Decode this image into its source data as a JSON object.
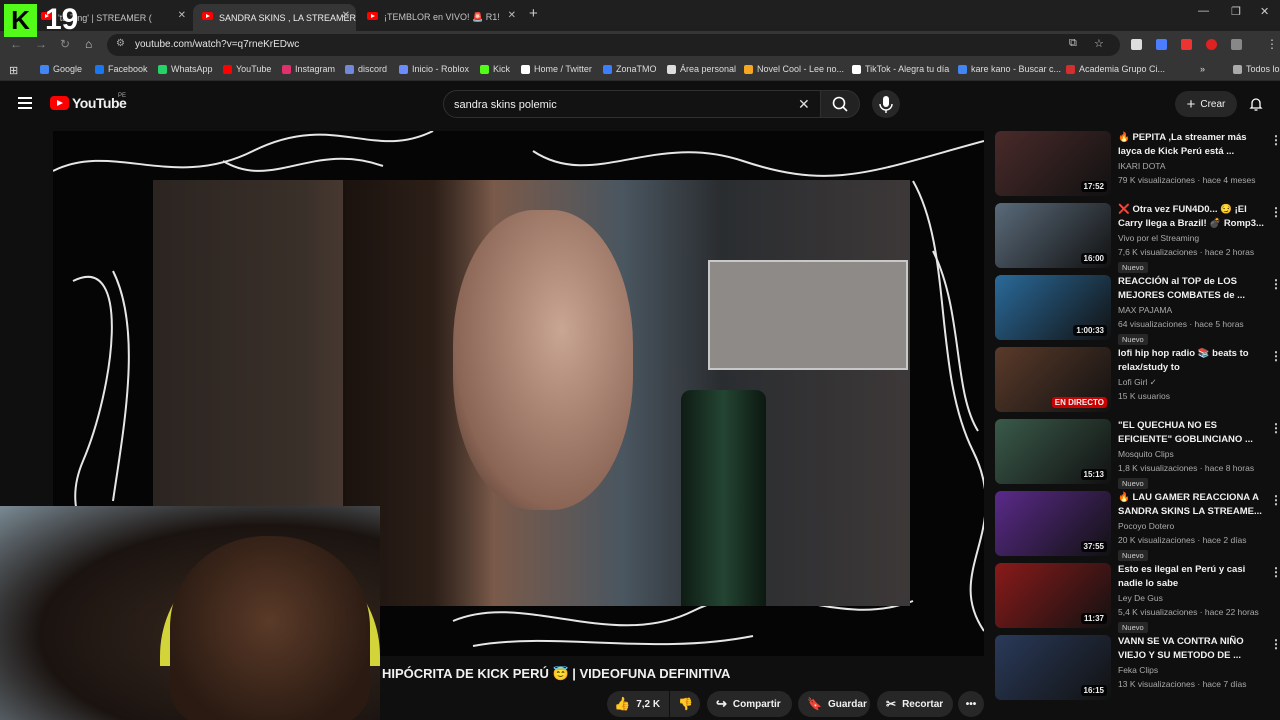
{
  "tabs": [
    {
      "label": "'ta Zing' | STREAMER ("
    },
    {
      "label": "SANDRA SKINS , LA STREAMER"
    },
    {
      "label": "¡TEMBLOR en VIVO! 🚨 R1!"
    }
  ],
  "address": {
    "url": "youtube.com/watch?v=q7rneKrEDwc"
  },
  "bookmarks": [
    {
      "label": "Google",
      "color": "#4285f4"
    },
    {
      "label": "Facebook",
      "color": "#1877f2"
    },
    {
      "label": "WhatsApp",
      "color": "#25d366"
    },
    {
      "label": "YouTube",
      "color": "#ff0000"
    },
    {
      "label": "Instagram",
      "color": "#e1306c"
    },
    {
      "label": "discord",
      "color": "#7289da"
    },
    {
      "label": "Inicio - Roblox",
      "color": "#6b8cff"
    },
    {
      "label": "Kick",
      "color": "#53fc18"
    },
    {
      "label": "Home / Twitter",
      "color": "#ffffff"
    },
    {
      "label": "ZonaTMO",
      "color": "#3d7eff"
    },
    {
      "label": "Área personal",
      "color": "#dddddd"
    },
    {
      "label": "Novel Cool - Lee no...",
      "color": "#f5a623"
    },
    {
      "label": "TikTok - Alegra tu día",
      "color": "#ffffff"
    },
    {
      "label": "kare kano - Buscar c...",
      "color": "#4285f4"
    },
    {
      "label": "Academia Grupo Ci...",
      "color": "#d32f2f"
    }
  ],
  "bookmarks_other": "Todos los",
  "youtube": {
    "logo": "YouTube",
    "country": "PE",
    "search_query": "sandra skins polemic",
    "create_label": "Crear"
  },
  "overlay": {
    "number": "19",
    "k_logo": "K"
  },
  "video": {
    "title": "HIPÓCRITA DE KICK PERÚ 😇 | VIDEOFUNA DEFINITIVA",
    "likes": "7,2 K",
    "share_label": "Compartir",
    "save_label": "Guardar",
    "clip_label": "Recortar"
  },
  "related": [
    {
      "title": "🔥 PEPITA ,La streamer más layca de Kick Perú está ...",
      "channel": "IKARI DOTA",
      "meta": "79 K visualizaciones · hace 4 meses",
      "duration": "17:52",
      "badge": "",
      "thumb": "#4a2a2a"
    },
    {
      "title": "❌ Otra vez FUN4D0... 😏 ¡El Carry llega a Brazil! 💣 Romp3...",
      "channel": "Vivo por el Streaming",
      "meta": "7,6 K visualizaciones · hace 2 horas",
      "duration": "16:00",
      "badge": "Nuevo",
      "thumb": "#5a6a7a"
    },
    {
      "title": "REACCIÓN al TOP de LOS MEJORES COMBATES de ...",
      "channel": "MAX PAJAMA",
      "meta": "64 visualizaciones · hace 5 horas",
      "duration": "1:00:33",
      "badge": "Nuevo",
      "thumb": "#2a6a9a"
    },
    {
      "title": "lofi hip hop radio 📚 beats to relax/study to",
      "channel": "Lofi Girl ✓",
      "meta": "15 K usuarios",
      "duration": "EN DIRECTO",
      "badge": "",
      "thumb": "#5a3a2a"
    },
    {
      "title": "\"EL QUECHUA NO ES EFICIENTE\" GOBLINCIANO ...",
      "channel": "Mosquito Clips",
      "meta": "1,8 K visualizaciones · hace 8 horas",
      "duration": "15:13",
      "badge": "Nuevo",
      "thumb": "#3a5a4a"
    },
    {
      "title": "🔥 LAU GAMER REACCIONA A SANDRA SKINS LA STREAME...",
      "channel": "Pocoyo Dotero",
      "meta": "20 K visualizaciones · hace 2 días",
      "duration": "37:55",
      "badge": "Nuevo",
      "thumb": "#5a2a8a"
    },
    {
      "title": "Esto es ilegal en Perú y casi nadie lo sabe",
      "channel": "Ley De Gus",
      "meta": "5,4 K visualizaciones · hace 22 horas",
      "duration": "11:37",
      "badge": "Nuevo",
      "thumb": "#8a1a1a"
    },
    {
      "title": "VANN SE VA CONTRA NIÑO VIEJO Y SU METODO DE ...",
      "channel": "Feka Clips",
      "meta": "13 K visualizaciones · hace 7 días",
      "duration": "16:15",
      "badge": "",
      "thumb": "#2a3a5a"
    }
  ]
}
